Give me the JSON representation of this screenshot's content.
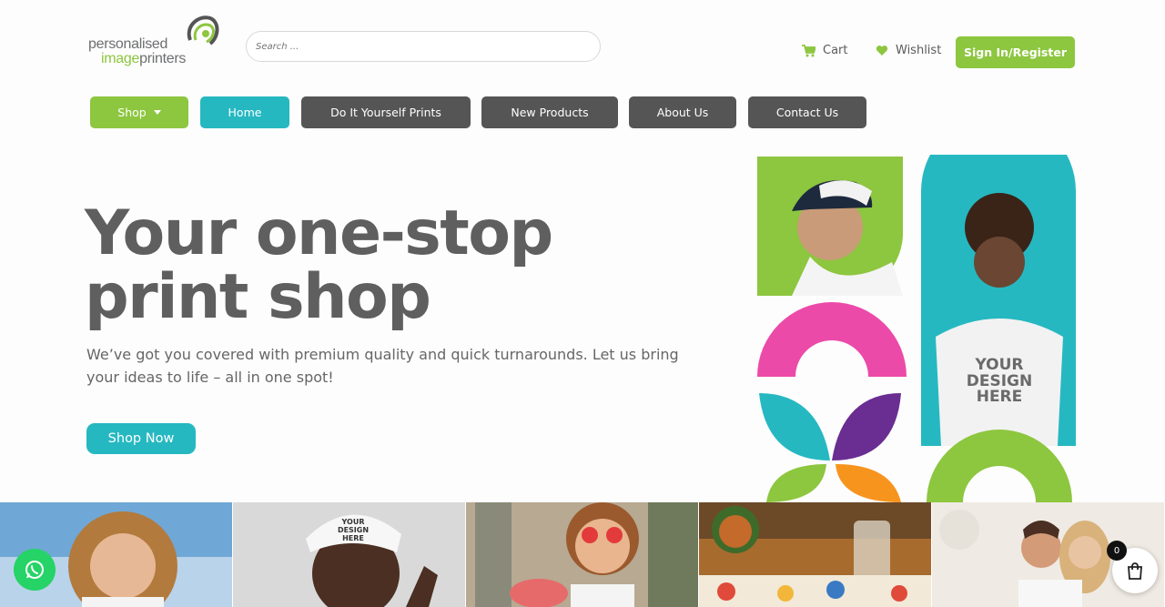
{
  "logo": {
    "line1": "personalised",
    "line2_a": "image",
    "line2_b": "printers"
  },
  "search": {
    "placeholder": "Search ..."
  },
  "header": {
    "cart_label": "Cart",
    "wishlist_label": "Wishlist",
    "signin_label": "Sign In/Register"
  },
  "nav": {
    "shop": "Shop",
    "home": "Home",
    "diy": "Do It Yourself Prints",
    "new_products": "New Products",
    "about": "About Us",
    "contact": "Contact Us"
  },
  "hero": {
    "title": "Your one-stop print shop",
    "subtitle": "We’ve got you covered with premium quality and quick turnarounds. Let us bring your ideas to life – all in one spot!",
    "cta": "Shop Now",
    "tshirt_text": "YOUR DESIGN HERE"
  },
  "floating": {
    "cart_count": "0"
  },
  "colors": {
    "green": "#8dc63f",
    "teal": "#26b8c1",
    "dark": "#555556",
    "pink": "#ec4aa8",
    "purple": "#6a2d91",
    "orange": "#f7941d"
  }
}
